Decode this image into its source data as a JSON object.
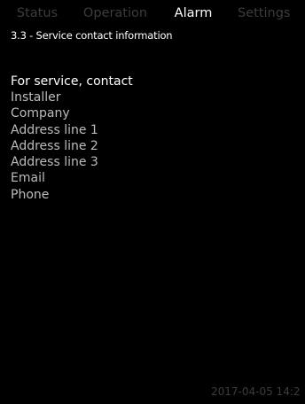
{
  "tabs": {
    "status": "Status",
    "operation": "Operation",
    "alarm": "Alarm",
    "settings": "Settings",
    "active": "Alarm"
  },
  "page": {
    "title": "3.3 - Service contact information"
  },
  "service": {
    "heading": "For service, contact",
    "fields": [
      "Installer",
      "Company",
      "Address line 1",
      "Address line 2",
      "Address line 3",
      "Email",
      "Phone"
    ]
  },
  "footer": {
    "timestamp": "2017-04-05 14:2"
  },
  "colors": {
    "background": "#000000",
    "active_text": "#ffffff",
    "inactive_text": "#3c3c3c",
    "field_text": "#bcbcbc"
  }
}
